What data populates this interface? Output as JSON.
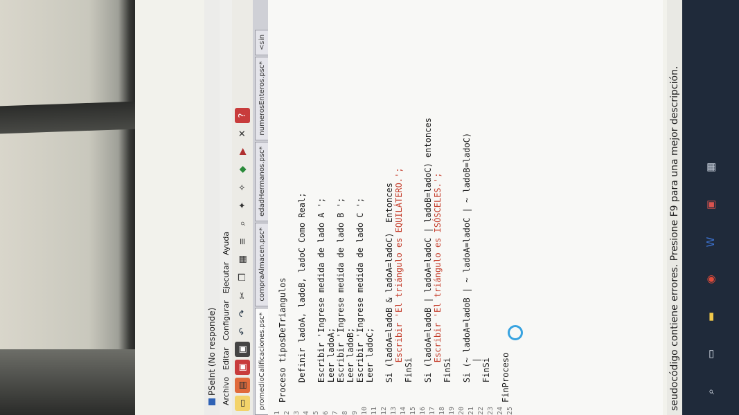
{
  "window": {
    "title": "PSeInt (No responde)"
  },
  "menu": {
    "items": [
      "Archivo",
      "Editar",
      "Configurar",
      "Ejecutar",
      "Ayuda"
    ]
  },
  "toolbar": {
    "icons": [
      "new-file-icon",
      "open-icon",
      "save-icon",
      "save-as-icon",
      "undo-icon",
      "redo-icon",
      "cut-icon",
      "copy-icon",
      "paste-icon",
      "indent-icon",
      "search-icon",
      "run-icon",
      "step-icon",
      "debug-icon",
      "flowchart-icon",
      "stop-icon",
      "help-icon"
    ]
  },
  "tabs": [
    {
      "label": "promedioCalificaciones.psc*",
      "active": true
    },
    {
      "label": "compraAlmacen.psc*",
      "active": false
    },
    {
      "label": "edadHermanos.psc*",
      "active": false
    },
    {
      "label": "numerosEnteros.psc*",
      "active": false
    },
    {
      "label": "<sin",
      "active": false
    }
  ],
  "code": [
    {
      "n": "1",
      "text": "Proceso tiposDeTriangulos"
    },
    {
      "n": "2",
      "text": ""
    },
    {
      "n": "3",
      "text": "    Definir ladoA, ladoB, ladoC Como Real;"
    },
    {
      "n": "4",
      "text": ""
    },
    {
      "n": "5",
      "text": "    Escribir 'Ingrese medida de lado A ';"
    },
    {
      "n": "6",
      "text": "    Leer ladoA;"
    },
    {
      "n": "7",
      "text": "    Escribir 'Ingrese medida de lado B ';"
    },
    {
      "n": "8",
      "text": "    Leer ladoB;"
    },
    {
      "n": "9",
      "text": "    Escribir 'Ingrese medida de lado C ';"
    },
    {
      "n": "10",
      "text": "    Leer ladoC;"
    },
    {
      "n": "11",
      "text": ""
    },
    {
      "n": "12",
      "text": "    Si (ladoA=ladoB & ladoA=ladoC)  Entonces"
    },
    {
      "n": "13",
      "text": "        Escribir 'El triángulo es EQUILÁTERO.';"
    },
    {
      "n": "14",
      "text": "    FinSi"
    },
    {
      "n": "15",
      "text": ""
    },
    {
      "n": "16",
      "text": "    Si (ladoA=ladoB | ladoA=ladoC | ladoB=ladoC) entonces"
    },
    {
      "n": "17",
      "text": "        Escribir 'El triángulo es ISÓSCELES.';"
    },
    {
      "n": "18",
      "text": "    FinSi"
    },
    {
      "n": "19",
      "text": ""
    },
    {
      "n": "20",
      "text": "    Si (~ ladoA=ladoB | ~ ladoA=ladoC | ~ ladoB=ladoC)"
    },
    {
      "n": "21",
      "text": "        |"
    },
    {
      "n": "22",
      "text": "    FinSi"
    },
    {
      "n": "23",
      "text": ""
    },
    {
      "n": "24",
      "text": "FinProceso"
    },
    {
      "n": "25",
      "text": ""
    }
  ],
  "status": {
    "message": "seudocódigo contiene errores. Presione F9 para una mejor descripción."
  },
  "taskbar": {
    "icons": [
      "search-icon",
      "task-view-icon",
      "file-explorer-icon",
      "chrome-icon",
      "word-icon",
      "store-icon",
      "app-icon"
    ]
  }
}
